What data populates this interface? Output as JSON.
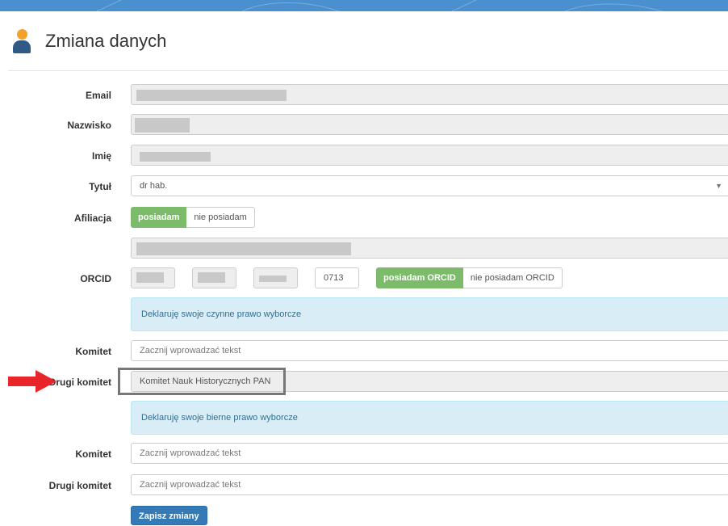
{
  "header": {
    "title": "Zmiana danych"
  },
  "form": {
    "email_label": "Email",
    "surname_label": "Nazwisko",
    "firstname_label": "Imię",
    "title_label": "Tytuł",
    "title_value": "dr hab.",
    "affiliation_label": "Afiliacja",
    "affiliation_has": "posiadam",
    "affiliation_hasnot": "nie posiadam",
    "orcid_label": "ORCID",
    "orcid_part4": "0713",
    "orcid_has": "posiadam ORCID",
    "orcid_hasnot": "nie posiadam ORCID",
    "active_info": "Deklaruję swoje czynne prawo wyborcze",
    "committee_label": "Komitet",
    "committee_placeholder": "Zacznij wprowadzać tekst",
    "second_committee_label": "Drugi komitet",
    "second_committee_value": "Komitet Nauk Historycznych PAN",
    "passive_info": "Deklaruję swoje bierne prawo wyborcze",
    "committee2_label": "Komitet",
    "committee2_placeholder": "Zacznij wprowadzać tekst",
    "second_committee2_label": "Drugi komitet",
    "second_committee2_placeholder": "Zacznij wprowadzać tekst",
    "save_label": "Zapisz zmiany"
  },
  "colors": {
    "topbar": "#4a90cf",
    "success": "#7cbb6a",
    "info_bg": "#d9edf7",
    "primary": "#337ab7",
    "arrow": "#e8262a"
  },
  "icons": [
    "user-icon",
    "caret-down-icon",
    "red-arrow-icon"
  ]
}
